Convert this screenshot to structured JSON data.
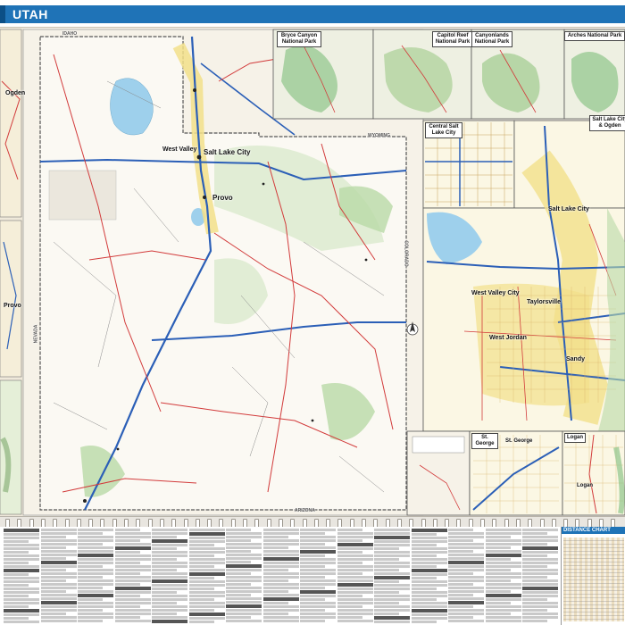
{
  "header": {
    "title": "UTAH"
  },
  "insets": {
    "bryce": "Bryce Canyon National Park",
    "capitol_reef": "Capitol Reef National Park",
    "canyonlands": "Canyonlands National Park",
    "arches": "Arches National Park",
    "slc_ogden": "Salt Lake City & Ogden",
    "central_slc": "Central Salt Lake City",
    "st_george": "St. George",
    "logan": "Logan"
  },
  "map_labels": {
    "ogden": "Ogden",
    "provo": "Provo",
    "salt_lake_city": "Salt Lake City",
    "west_valley": "West Valley",
    "west_valley_city": "West Valley City",
    "west_jordan": "West Jordan",
    "taylorsville": "Taylorsville",
    "sandy": "Sandy",
    "st_george_city": "St. George",
    "logan_city": "Logan",
    "nevada": "NEVADA",
    "idaho": "IDAHO",
    "wyoming": "WYOMING",
    "colorado": "COLORADO",
    "arizona": "ARIZONA"
  },
  "distance_chart": {
    "title": "DISTANCE CHART"
  },
  "colors": {
    "header_blue": "#1f73b7",
    "land": "#f3efe6",
    "park_green": "#8fc48a",
    "interstate_blue": "#2b5fb7",
    "highway_red": "#d23b3b",
    "water": "#9ed0ec",
    "urban_yellow": "#f2e08a"
  }
}
